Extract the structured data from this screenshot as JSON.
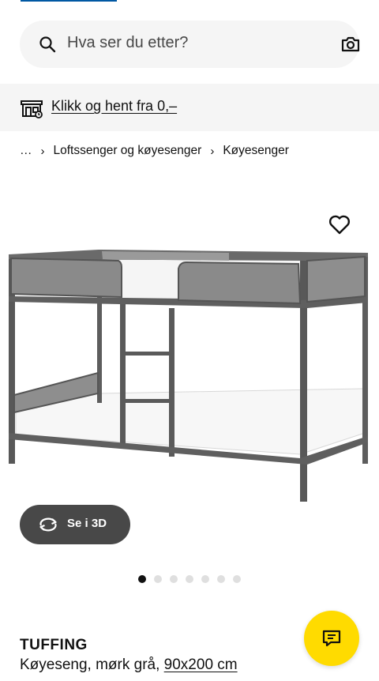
{
  "search": {
    "placeholder": "Hva ser du etter?"
  },
  "store_banner": {
    "link_text": "Klikk og hent fra 0,–"
  },
  "breadcrumb": {
    "items": [
      "…",
      "Loftssenger og køyesenger",
      "Køyesenger"
    ]
  },
  "product": {
    "name": "TUFFING",
    "description": "Køyeseng, mørk grå, ",
    "size": "90x200 cm",
    "image_count": 7,
    "active_image": 1
  },
  "view_3d": {
    "label": "Se i 3D"
  },
  "colors": {
    "accent_blue": "#0058a3",
    "fab_yellow": "#ffdb00",
    "button_dark": "#484848",
    "banner_bg": "#f5f5f5"
  },
  "icons": [
    "search-icon",
    "camera-icon",
    "store-icon",
    "heart-icon",
    "rotate-3d-icon",
    "chat-icon"
  ]
}
